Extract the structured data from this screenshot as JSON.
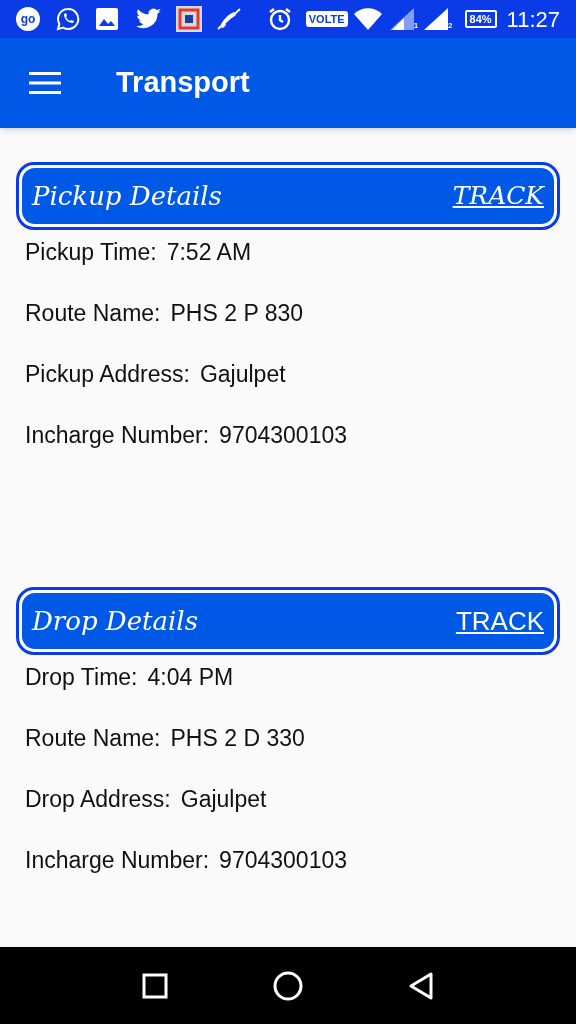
{
  "status_bar": {
    "left_icons": [
      {
        "kind": "go",
        "text": "go"
      },
      {
        "kind": "whatsapp"
      },
      {
        "kind": "gallery"
      },
      {
        "kind": "twitter"
      },
      {
        "kind": "app"
      },
      {
        "kind": "muted"
      }
    ],
    "volte": "VOLTE",
    "sim_1": "1",
    "sim_2": "2",
    "battery": "84%",
    "time": "11:27"
  },
  "app_bar": {
    "title": "Transport"
  },
  "sections": [
    {
      "title": "Pickup Details",
      "track": {
        "label": "TRACK",
        "kind": "serif"
      },
      "rows": [
        {
          "label": "Pickup Time:",
          "value": "7:52 AM"
        },
        {
          "label": "Route Name:",
          "value": "PHS 2 P 830"
        },
        {
          "label": "Pickup Address:",
          "value": "Gajulpet"
        },
        {
          "label": "Incharge Number:",
          "value": "9704300103"
        }
      ]
    },
    {
      "title": "Drop Details",
      "track": {
        "label": "TRACK",
        "kind": "sans"
      },
      "rows": [
        {
          "label": "Drop Time:",
          "value": "4:04 PM"
        },
        {
          "label": "Route Name:",
          "value": "PHS 2 D 330"
        },
        {
          "label": "Drop Address:",
          "value": "Gajulpet"
        },
        {
          "label": "Incharge Number:",
          "value": "9704300103"
        }
      ]
    }
  ]
}
